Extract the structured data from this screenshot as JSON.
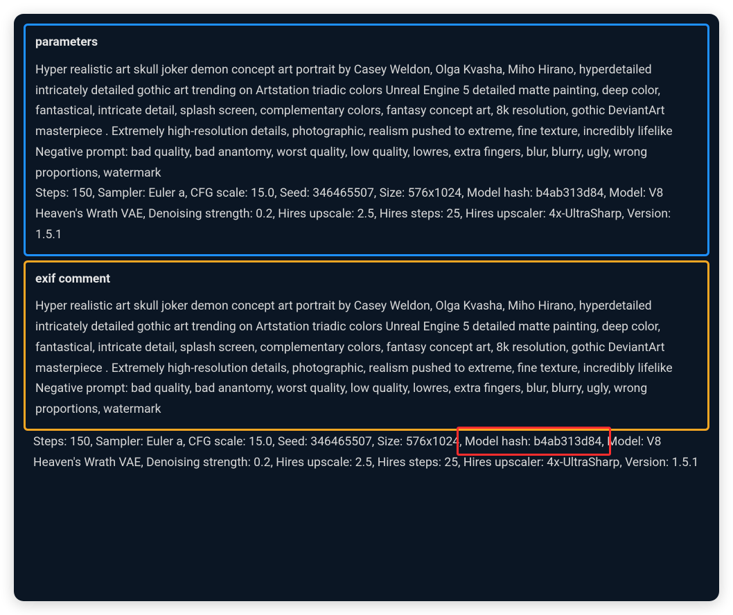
{
  "sections": {
    "parameters": {
      "heading": "parameters",
      "prompt": "Hyper realistic art skull joker demon concept art portrait by Casey Weldon, Olga Kvasha, Miho Hirano, hyperdetailed intricately detailed gothic art trending on Artstation triadic colors Unreal Engine 5 detailed matte painting, deep color, fantastical, intricate detail, splash screen, complementary colors, fantasy concept art, 8k resolution, gothic DeviantArt masterpiece . Extremely high-resolution details, photographic, realism pushed to extreme, fine texture, incredibly lifelike",
      "negative_prompt": "Negative prompt: bad quality, bad anantomy, worst quality, low quality, lowres, extra fingers, blur, blurry, ugly, wrong proportions, watermark",
      "settings": "Steps: 150, Sampler: Euler a, CFG scale: 15.0, Seed: 346465507, Size: 576x1024, Model hash: b4ab313d84, Model: V8 Heaven's Wrath VAE, Denoising strength: 0.2, Hires upscale: 2.5, Hires steps: 25, Hires upscaler: 4x-UltraSharp, Version: 1.5.1"
    },
    "exif": {
      "heading": "exif comment",
      "prompt": "Hyper realistic art skull joker demon concept art portrait by Casey Weldon, Olga Kvasha, Miho Hirano, hyperdetailed intricately detailed gothic art trending on Artstation triadic colors Unreal Engine 5 detailed matte painting, deep color, fantastical, intricate detail, splash screen, complementary colors, fantasy concept art, 8k resolution, gothic DeviantArt masterpiece . Extremely high-resolution details, photographic, realism pushed to extreme, fine texture, incredibly lifelike",
      "negative_prompt": "Negative prompt: bad quality, bad anantomy, worst quality, low quality, lowres, extra fingers, blur, blurry, ugly, wrong proportions, watermark"
    },
    "trailing_settings": "Steps: 150, Sampler: Euler a, CFG scale: 15.0, Seed: 346465507, Size: 576x1024, Model hash: b4ab313d84, Model: V8 Heaven's Wrath VAE, Denoising strength: 0.2, Hires upscale: 2.5, Hires steps: 25, Hires upscaler: 4x-UltraSharp, Version: 1.5.1"
  },
  "highlight": {
    "fragment": "Model hash: b4ab313d84"
  }
}
